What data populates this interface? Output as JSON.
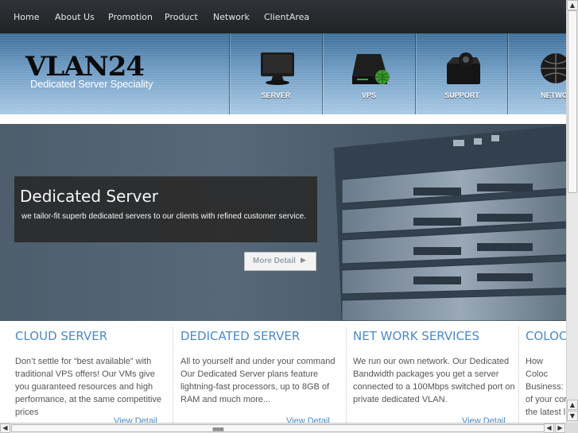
{
  "nav": {
    "items": [
      "Home",
      "About Us",
      "Promotion",
      "Product",
      "Network",
      "ClientArea"
    ]
  },
  "logo": {
    "name": "VLAN24",
    "tagline": "Dedicated Server Speciality"
  },
  "header_tiles": [
    {
      "label": "SERVER",
      "icon": "monitor-icon"
    },
    {
      "label": "VPS",
      "icon": "hard-drive-globe-icon"
    },
    {
      "label": "SUPPORT",
      "icon": "support-box-icon"
    },
    {
      "label": "NETWO",
      "icon": "globe-icon"
    }
  ],
  "hero": {
    "title": "Dedicated Server",
    "subtitle": "we tailor-fit superb dedicated servers to our clients with refined customer service.",
    "button_label": "More Detail",
    "button_icon": "triangle-right-icon"
  },
  "columns": [
    {
      "title": "CLOUD SERVER",
      "text": "Don’t settle for “best available” with traditional VPS offers! Our VMs give you guaranteed resources and high performance, at the same competitive prices",
      "link": "View Detail"
    },
    {
      "title": "DEDICATED SERVER",
      "text": "All to yourself and under your command Our Dedicated Server plans feature lightning-fast processors, up to 8GB of RAM and much more...",
      "link": "View Detail"
    },
    {
      "title": "NET WORK SERVICES",
      "text": "We run our own network. Our Dedicated Bandwidth packages you get a server connected to a 100Mbps switched port on private dedicated VLAN.",
      "link": "View Detail"
    },
    {
      "title": "COLOC",
      "text": "How Coloc Business: of your cor the latest l",
      "link": ""
    }
  ],
  "colors": {
    "nav_bg": "#2a2d30",
    "accent_blue": "#4b8ac2",
    "hero_box": "#2c2c2c"
  }
}
